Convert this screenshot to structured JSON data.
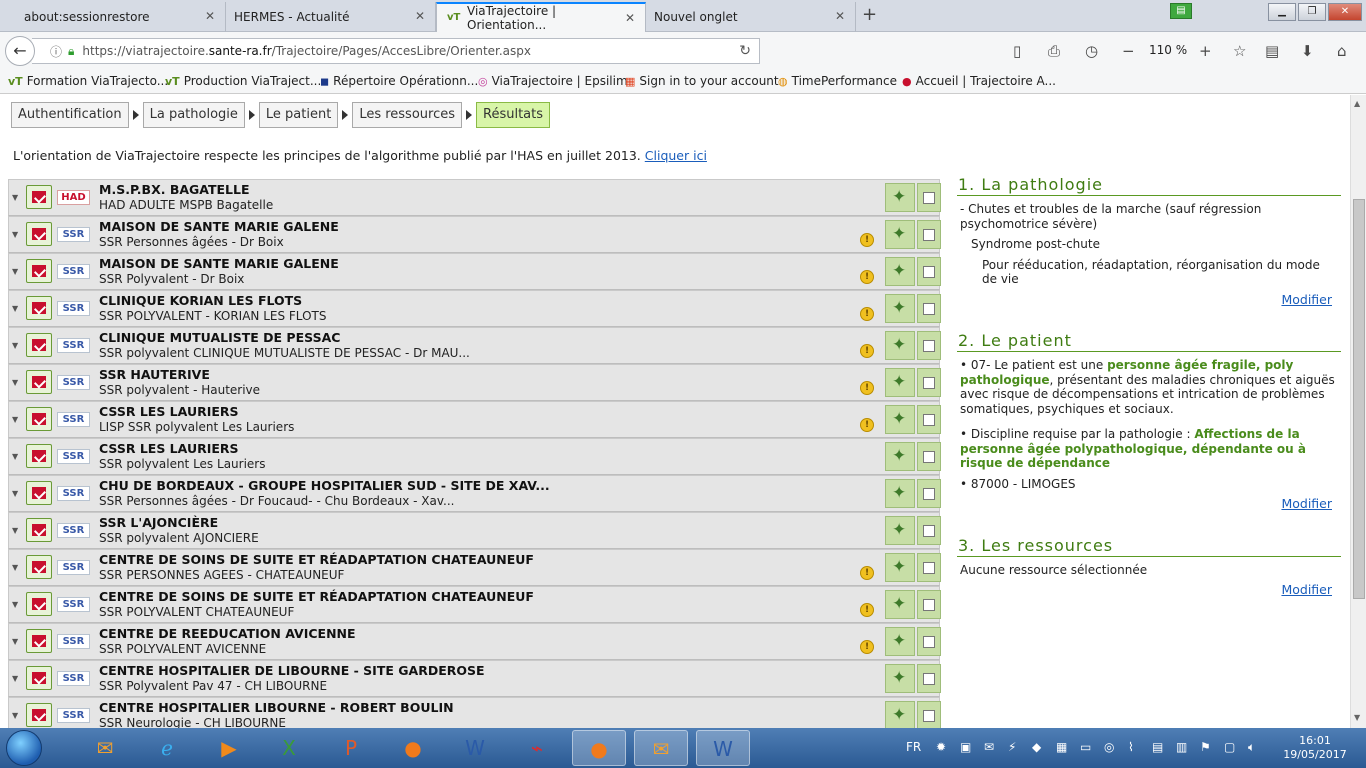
{
  "tabs": [
    {
      "label": "about:sessionrestore",
      "active": false
    },
    {
      "label": "HERMES - Actualité",
      "active": false
    },
    {
      "label": "ViaTrajectoire | Orientation...",
      "active": true
    },
    {
      "label": "Nouvel onglet",
      "active": false
    }
  ],
  "url": {
    "prefix": "https://viatrajectoire.",
    "host": "sante-ra.fr",
    "path": "/Trajectoire/Pages/AccesLibre/Orienter.aspx"
  },
  "zoom": "110 %",
  "bookmarks": [
    "Formation ViaTrajecto...",
    "Production ViaTraject...",
    "Répertoire Opérationn...",
    "ViaTrajectoire | Epsilim",
    "Sign in to your account",
    "TimePerformance",
    "Accueil | Trajectoire A..."
  ],
  "steps": [
    "Authentification",
    "La pathologie",
    "Le patient",
    "Les ressources",
    "Résultats"
  ],
  "intro": {
    "text": "L'orientation de ViaTrajectoire respecte les principes de l'algorithme publié par l'HAS en juillet 2013.",
    "link": "Cliquer ici"
  },
  "results": [
    {
      "type": "HAD",
      "name": "M.S.P.BX. BAGATELLE",
      "sub": "HAD ADULTE MSPB Bagatelle",
      "warn": false
    },
    {
      "type": "SSR",
      "name": "MAISON DE SANTE MARIE GALENE",
      "sub": "SSR Personnes âgées - Dr Boix",
      "warn": true
    },
    {
      "type": "SSR",
      "name": "MAISON DE SANTE MARIE GALENE",
      "sub": "SSR Polyvalent - Dr Boix",
      "warn": true
    },
    {
      "type": "SSR",
      "name": "CLINIQUE KORIAN LES FLOTS",
      "sub": "SSR POLYVALENT - KORIAN LES FLOTS",
      "warn": true
    },
    {
      "type": "SSR",
      "name": "CLINIQUE MUTUALISTE DE PESSAC",
      "sub": "SSR polyvalent CLINIQUE MUTUALISTE DE PESSAC - Dr MAU...",
      "warn": true
    },
    {
      "type": "SSR",
      "name": "SSR HAUTERIVE",
      "sub": "SSR polyvalent - Hauterive",
      "warn": true
    },
    {
      "type": "SSR",
      "name": "CSSR LES LAURIERS",
      "sub": "LISP SSR polyvalent Les Lauriers",
      "warn": true
    },
    {
      "type": "SSR",
      "name": "CSSR LES LAURIERS",
      "sub": "SSR polyvalent Les Lauriers",
      "warn": false
    },
    {
      "type": "SSR",
      "name": "CHU DE BORDEAUX - GROUPE HOSPITALIER SUD - SITE DE XAV...",
      "sub": "SSR Personnes âgées - Dr Foucaud- - Chu Bordeaux - Xav...",
      "warn": false
    },
    {
      "type": "SSR",
      "name": "SSR L'AJONCIÈRE",
      "sub": "SSR polyvalent AJONCIERE",
      "warn": false
    },
    {
      "type": "SSR",
      "name": "CENTRE DE SOINS DE SUITE ET RÉADAPTATION CHATEAUNEUF",
      "sub": "SSR PERSONNES AGEES - CHATEAUNEUF",
      "warn": true
    },
    {
      "type": "SSR",
      "name": "CENTRE DE SOINS DE SUITE ET RÉADAPTATION CHATEAUNEUF",
      "sub": "SSR POLYVALENT CHATEAUNEUF",
      "warn": true
    },
    {
      "type": "SSR",
      "name": "CENTRE DE REEDUCATION AVICENNE",
      "sub": "SSR POLYVALENT AVICENNE",
      "warn": true
    },
    {
      "type": "SSR",
      "name": "CENTRE HOSPITALIER DE LIBOURNE - SITE GARDEROSE",
      "sub": "SSR Polyvalent Pav 47 - CH LIBOURNE",
      "warn": false
    },
    {
      "type": "SSR",
      "name": "CENTRE HOSPITALIER LIBOURNE - ROBERT BOULIN",
      "sub": "SSR Neurologie - CH LIBOURNE",
      "warn": false
    }
  ],
  "panel": {
    "pathologie": {
      "title": "1. La pathologie",
      "l1": "- Chutes et troubles de la marche (sauf régression psychomotrice sévère)",
      "l2": "Syndrome post-chute",
      "l3": "Pour rééducation, réadaptation, réorganisation du mode de vie",
      "modifier": "Modifier"
    },
    "patient": {
      "title": "2. Le patient",
      "p1_a": "• 07- Le patient est une ",
      "p1_hl": "personne âgée fragile, poly pathologique",
      "p1_b": ", présentant des maladies chroniques et aiguës avec risque de décompensations et intrication de problèmes somatiques, psychiques et sociaux.",
      "p2_a": "• Discipline requise par la pathologie : ",
      "p2_hl": "Affections de la personne âgée polypathologique, dépendante ou à risque de dépendance",
      "p3": "• 87000 - LIMOGES",
      "modifier": "Modifier"
    },
    "ressources": {
      "title": "3. Les ressources",
      "body": "Aucune ressource sélectionnée",
      "modifier": "Modifier"
    }
  },
  "tray": {
    "lang": "FR",
    "time": "16:01",
    "date": "19/05/2017"
  }
}
